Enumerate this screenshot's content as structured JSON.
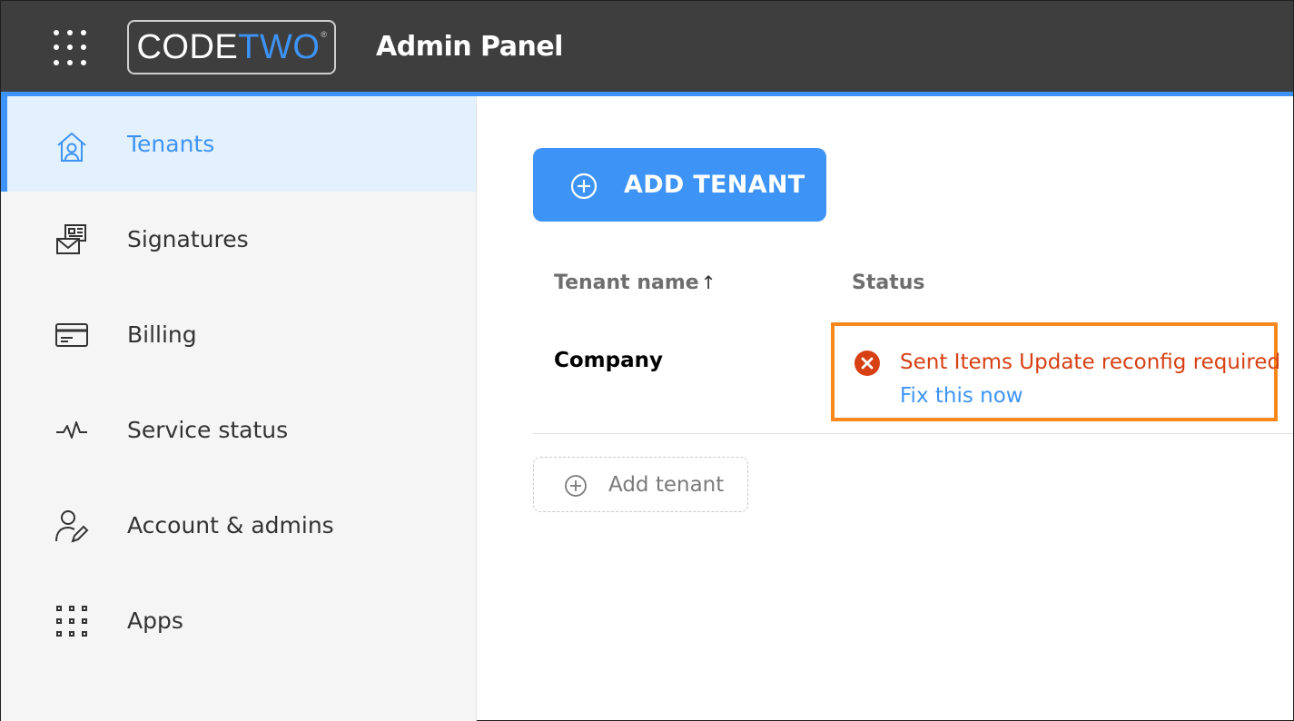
{
  "header": {
    "logo_code": "CODE",
    "logo_two": "TWO",
    "logo_reg": "®",
    "title": "Admin Panel",
    "app_launcher_icon": "waffle-grid-icon"
  },
  "sidebar": {
    "items": [
      {
        "label": "Tenants",
        "icon": "home-user-icon",
        "active": true
      },
      {
        "label": "Signatures",
        "icon": "signature-envelope-icon",
        "active": false
      },
      {
        "label": "Billing",
        "icon": "credit-card-icon",
        "active": false
      },
      {
        "label": "Service status",
        "icon": "pulse-icon",
        "active": false
      },
      {
        "label": "Account & admins",
        "icon": "user-edit-icon",
        "active": false
      },
      {
        "label": "Apps",
        "icon": "apps-grid-icon",
        "active": false
      }
    ]
  },
  "main": {
    "add_tenant_button": "ADD TENANT",
    "table": {
      "columns": [
        "Tenant name",
        "Status"
      ],
      "sort_indicator": "↑",
      "rows": [
        {
          "tenant_name": "Company",
          "status_text": "Sent Items Update reconfig required",
          "status_link": "Fix this now",
          "status_icon": "error-circle-icon"
        }
      ]
    },
    "add_tenant_inline": "Add tenant"
  },
  "colors": {
    "topbar": "#3e3e3e",
    "accent": "#3d94f6",
    "error": "#d64013",
    "highlight": "#f8881b",
    "sidebar_bg": "#f5f5f5",
    "active_bg": "#e3f0fd"
  }
}
